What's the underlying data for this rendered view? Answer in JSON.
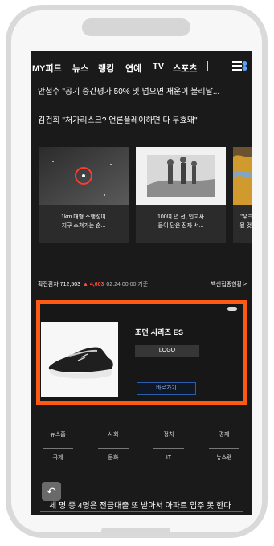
{
  "nav": {
    "items": [
      "MY피드",
      "뉴스",
      "랭킹",
      "연예",
      "TV",
      "스포츠"
    ]
  },
  "headlines": {
    "first": "안철수 \"공기 중간평가 50% 및 넘으면 재운이 불리날...",
    "second": "김건희 \"처가리스크? 언론플레이하면 다 무효돼\""
  },
  "cards": [
    {
      "label": "1km 대형 소행성이\n지구 스쳐가는 순..."
    },
    {
      "label": "100여 년 전, 인교사\n들이 담은 진짜 서..."
    },
    {
      "label": "\"우크\n될 것\""
    }
  ],
  "ticker": {
    "left_label": "확진환자 712,503",
    "delta": "▲ 4,603",
    "date": "02.24 00:00 기준",
    "right_link": "백신접종현황 >"
  },
  "ad": {
    "title": "조던 시리즈 ES",
    "logo": "LOGO",
    "cta": "바로가기"
  },
  "categories": [
    "뉴스홈",
    "사회",
    "정치",
    "경제",
    "국제",
    "문화",
    "IT",
    "뉴스랭"
  ],
  "bottom_headline": "세 명 중 4명은 전금대출 또 받아서 아파트 입주 못 한다",
  "icons": {
    "back": "back-icon",
    "menu": "menu-icon"
  }
}
